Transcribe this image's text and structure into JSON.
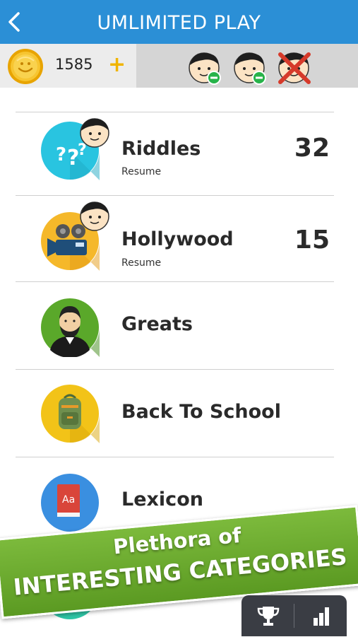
{
  "header": {
    "title": "UMLIMITED PLAY",
    "back_icon": "chevron-left-icon",
    "background": "#2b8fd6"
  },
  "status": {
    "coins": "1585",
    "plus_label": "+",
    "coin_icon": "coin-icon",
    "players": [
      {
        "state": "active",
        "icon": "player-face-icon"
      },
      {
        "state": "active",
        "icon": "player-face-icon"
      },
      {
        "state": "eliminated",
        "icon": "player-face-crossed-icon"
      }
    ]
  },
  "categories": [
    {
      "name": "Riddles",
      "sub": "Resume",
      "score": "32",
      "icon": "riddles-question-icon",
      "color": "#29c4e0"
    },
    {
      "name": "Hollywood",
      "sub": "Resume",
      "score": "15",
      "icon": "movie-camera-icon",
      "color": "#f5b82a"
    },
    {
      "name": "Greats",
      "sub": "",
      "score": "",
      "icon": "lincoln-portrait-icon",
      "color": "#5aa82a"
    },
    {
      "name": "Back To School",
      "sub": "",
      "score": "",
      "icon": "backpack-icon",
      "color": "#f2c318"
    },
    {
      "name": "Lexicon",
      "sub": "",
      "score": "",
      "icon": "dictionary-book-icon",
      "color": "#3a8fe0"
    }
  ],
  "banner": {
    "line1": "Plethora of",
    "line2": "INTERESTING CATEGORIES",
    "color": "#6aaa2e"
  },
  "tabs": {
    "leaderboard_icon": "trophy-icon",
    "stats_icon": "bar-chart-icon"
  }
}
